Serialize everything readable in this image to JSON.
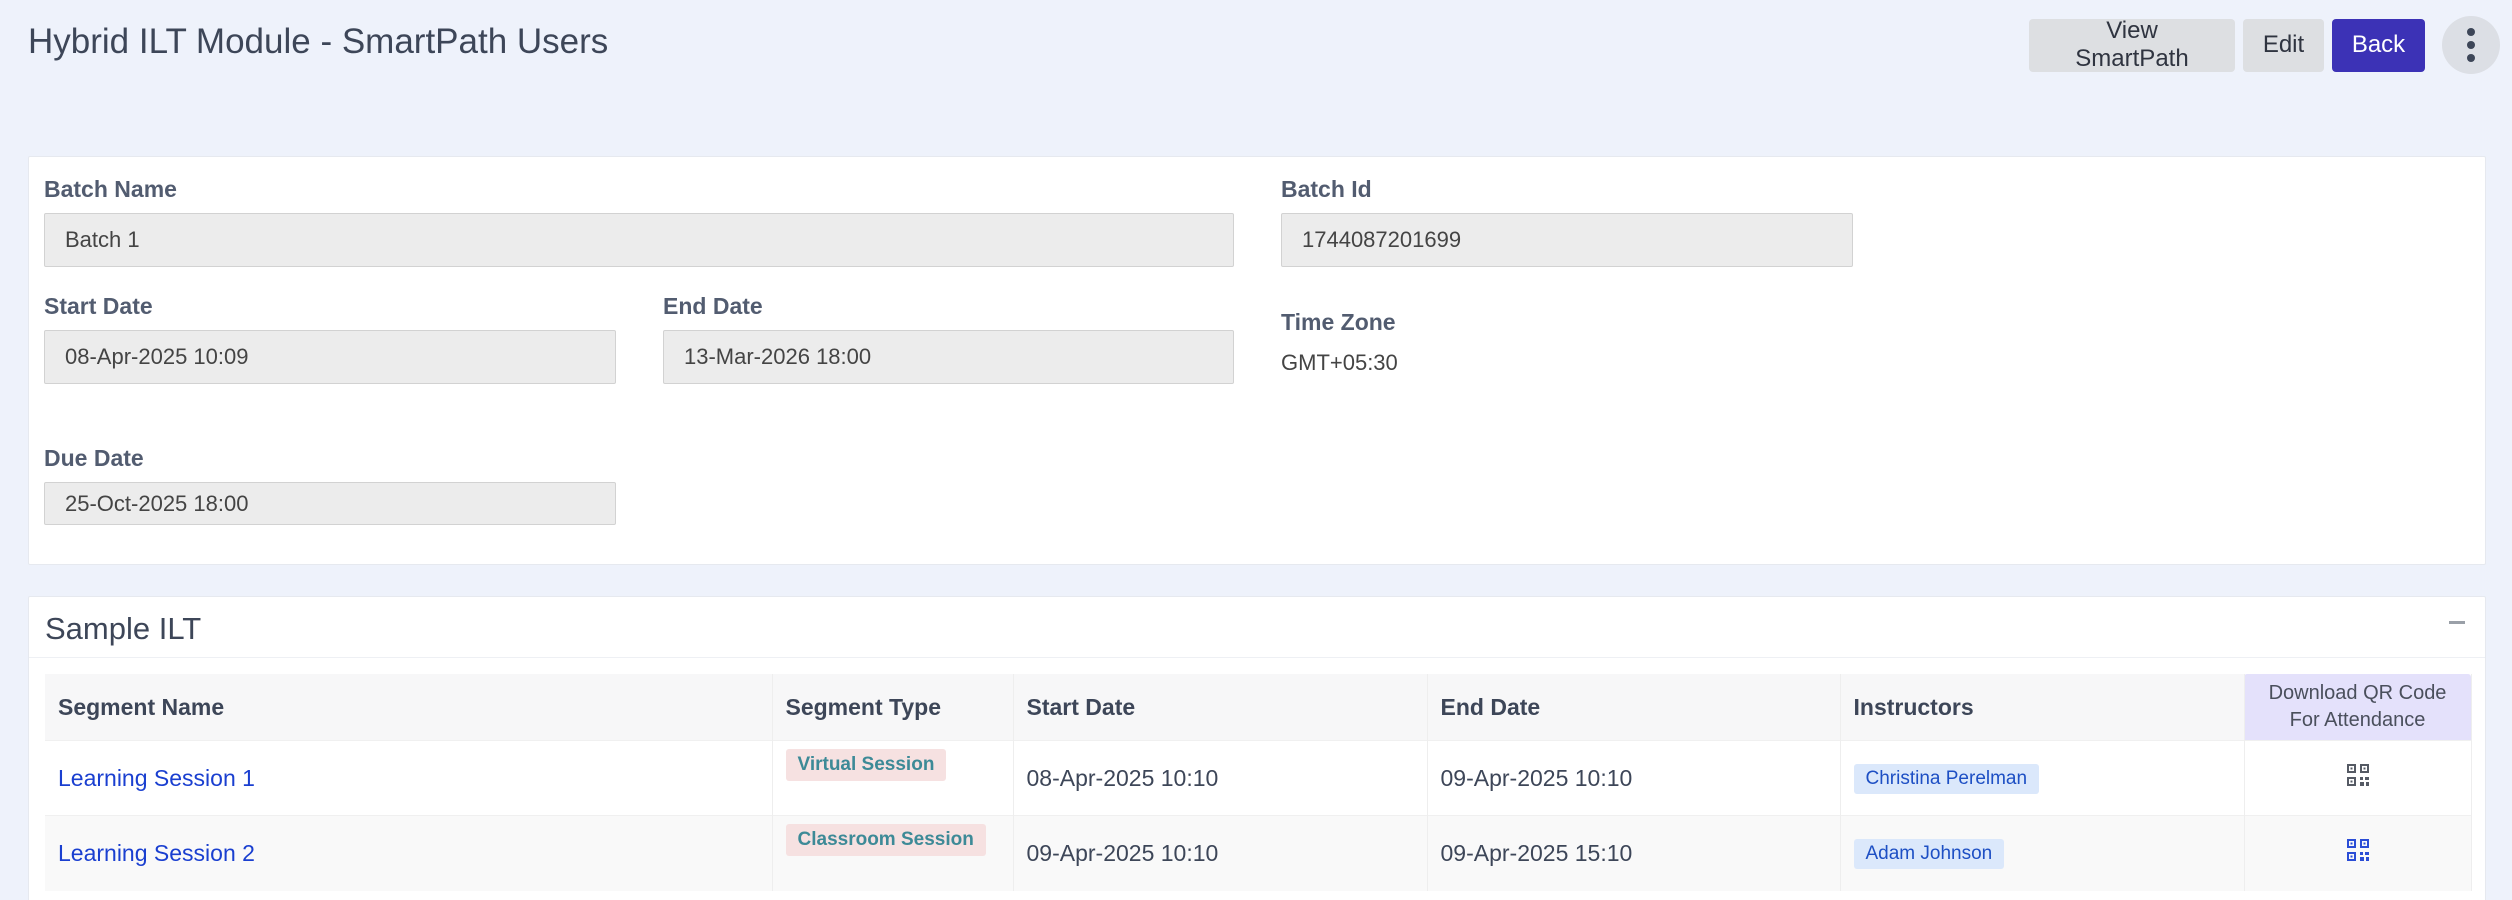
{
  "header": {
    "title": "Hybrid ILT Module - SmartPath Users",
    "view_smartpath_label": "View SmartPath",
    "edit_label": "Edit",
    "back_label": "Back",
    "more_icon": "kebab-vertical-icon"
  },
  "batch": {
    "batch_name_label": "Batch Name",
    "batch_name_value": "Batch 1",
    "batch_id_label": "Batch Id",
    "batch_id_value": "1744087201699",
    "start_date_label": "Start Date",
    "start_date_value": "08-Apr-2025 10:09",
    "end_date_label": "End Date",
    "end_date_value": "13-Mar-2026 18:00",
    "time_zone_label": "Time Zone",
    "time_zone_value": "GMT+05:30",
    "due_date_label": "Due Date",
    "due_date_value": "25-Oct-2025 18:00"
  },
  "ilt": {
    "title": "Sample ILT",
    "collapse_icon": "minus-icon",
    "columns": {
      "segment_name": "Segment Name",
      "segment_type": "Segment Type",
      "start_date": "Start Date",
      "end_date": "End Date",
      "instructors": "Instructors",
      "qr": "Download QR Code For Attendance"
    },
    "rows": [
      {
        "segment_name": "Learning Session 1",
        "segment_type": "Virtual Session",
        "start_date": "08-Apr-2025 10:10",
        "end_date": "09-Apr-2025 10:10",
        "instructor": "Christina Perelman",
        "qr_icon": "qr-code-icon"
      },
      {
        "segment_name": "Learning Session 2",
        "segment_type": "Classroom Session",
        "start_date": "09-Apr-2025 10:10",
        "end_date": "09-Apr-2025 15:10",
        "instructor": "Adam Johnson",
        "qr_icon": "qr-code-icon"
      }
    ]
  },
  "colors": {
    "page_background": "#eef2fb",
    "primary_button": "#3c32b6",
    "link": "#1a3fd0",
    "qr_header_bg": "#e4e1fb"
  }
}
